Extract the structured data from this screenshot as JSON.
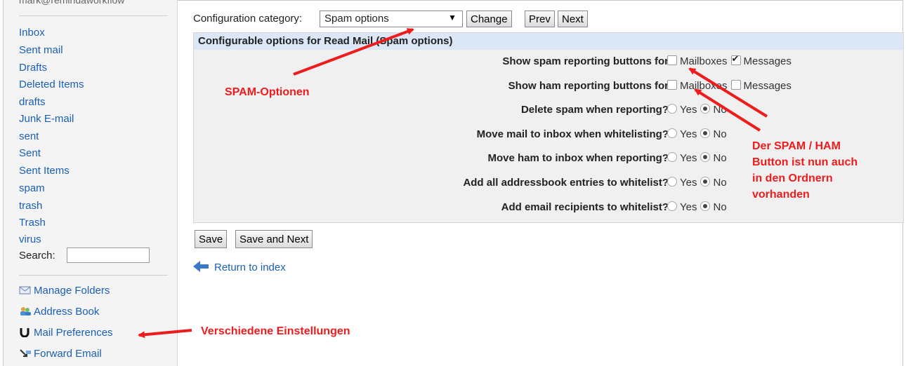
{
  "sidebar": {
    "user": "mark@remindaworkflow",
    "folders": [
      "Inbox",
      "Sent mail",
      "Drafts",
      "Deleted Items",
      "drafts",
      "Junk E-mail",
      "sent",
      "Sent",
      "Sent Items",
      "spam",
      "trash",
      "Trash",
      "virus"
    ],
    "search_label": "Search:",
    "tools": [
      "Manage Folders",
      "Address Book",
      "Mail Preferences",
      "Forward Email"
    ]
  },
  "main": {
    "category_label": "Configuration category:",
    "category_value": "Spam options",
    "change": "Change",
    "prev": "Prev",
    "next": "Next",
    "panel_title": "Configurable options for Read Mail (Spam options)",
    "options": [
      {
        "label": "Show spam reporting buttons for",
        "kind": "check",
        "a": "Mailboxes",
        "b": "Messages",
        "a_on": false,
        "b_on": true
      },
      {
        "label": "Show ham reporting buttons for",
        "kind": "check",
        "a": "Mailboxes",
        "b": "Messages",
        "a_on": false,
        "b_on": false
      },
      {
        "label": "Delete spam when reporting?",
        "kind": "radio",
        "a": "Yes",
        "b": "No",
        "a_on": false,
        "b_on": true
      },
      {
        "label": "Move mail to inbox when whitelisting?",
        "kind": "radio",
        "a": "Yes",
        "b": "No",
        "a_on": false,
        "b_on": true
      },
      {
        "label": "Move ham to inbox when reporting?",
        "kind": "radio",
        "a": "Yes",
        "b": "No",
        "a_on": false,
        "b_on": true
      },
      {
        "label": "Add all addressbook entries to whitelist?",
        "kind": "radio",
        "a": "Yes",
        "b": "No",
        "a_on": false,
        "b_on": true
      },
      {
        "label": "Add email recipients to whitelist?",
        "kind": "radio",
        "a": "Yes",
        "b": "No",
        "a_on": false,
        "b_on": true
      }
    ],
    "save": "Save",
    "save_next": "Save and Next",
    "return": "Return to index"
  },
  "annotations": {
    "spam": "SPAM-Optionen",
    "button": [
      "Der SPAM / HAM",
      "Button ist nun auch",
      "in den Ordnern",
      "vorhanden"
    ],
    "settings": "Verschiedene Einstellungen",
    "color": "#ee1c1c"
  }
}
